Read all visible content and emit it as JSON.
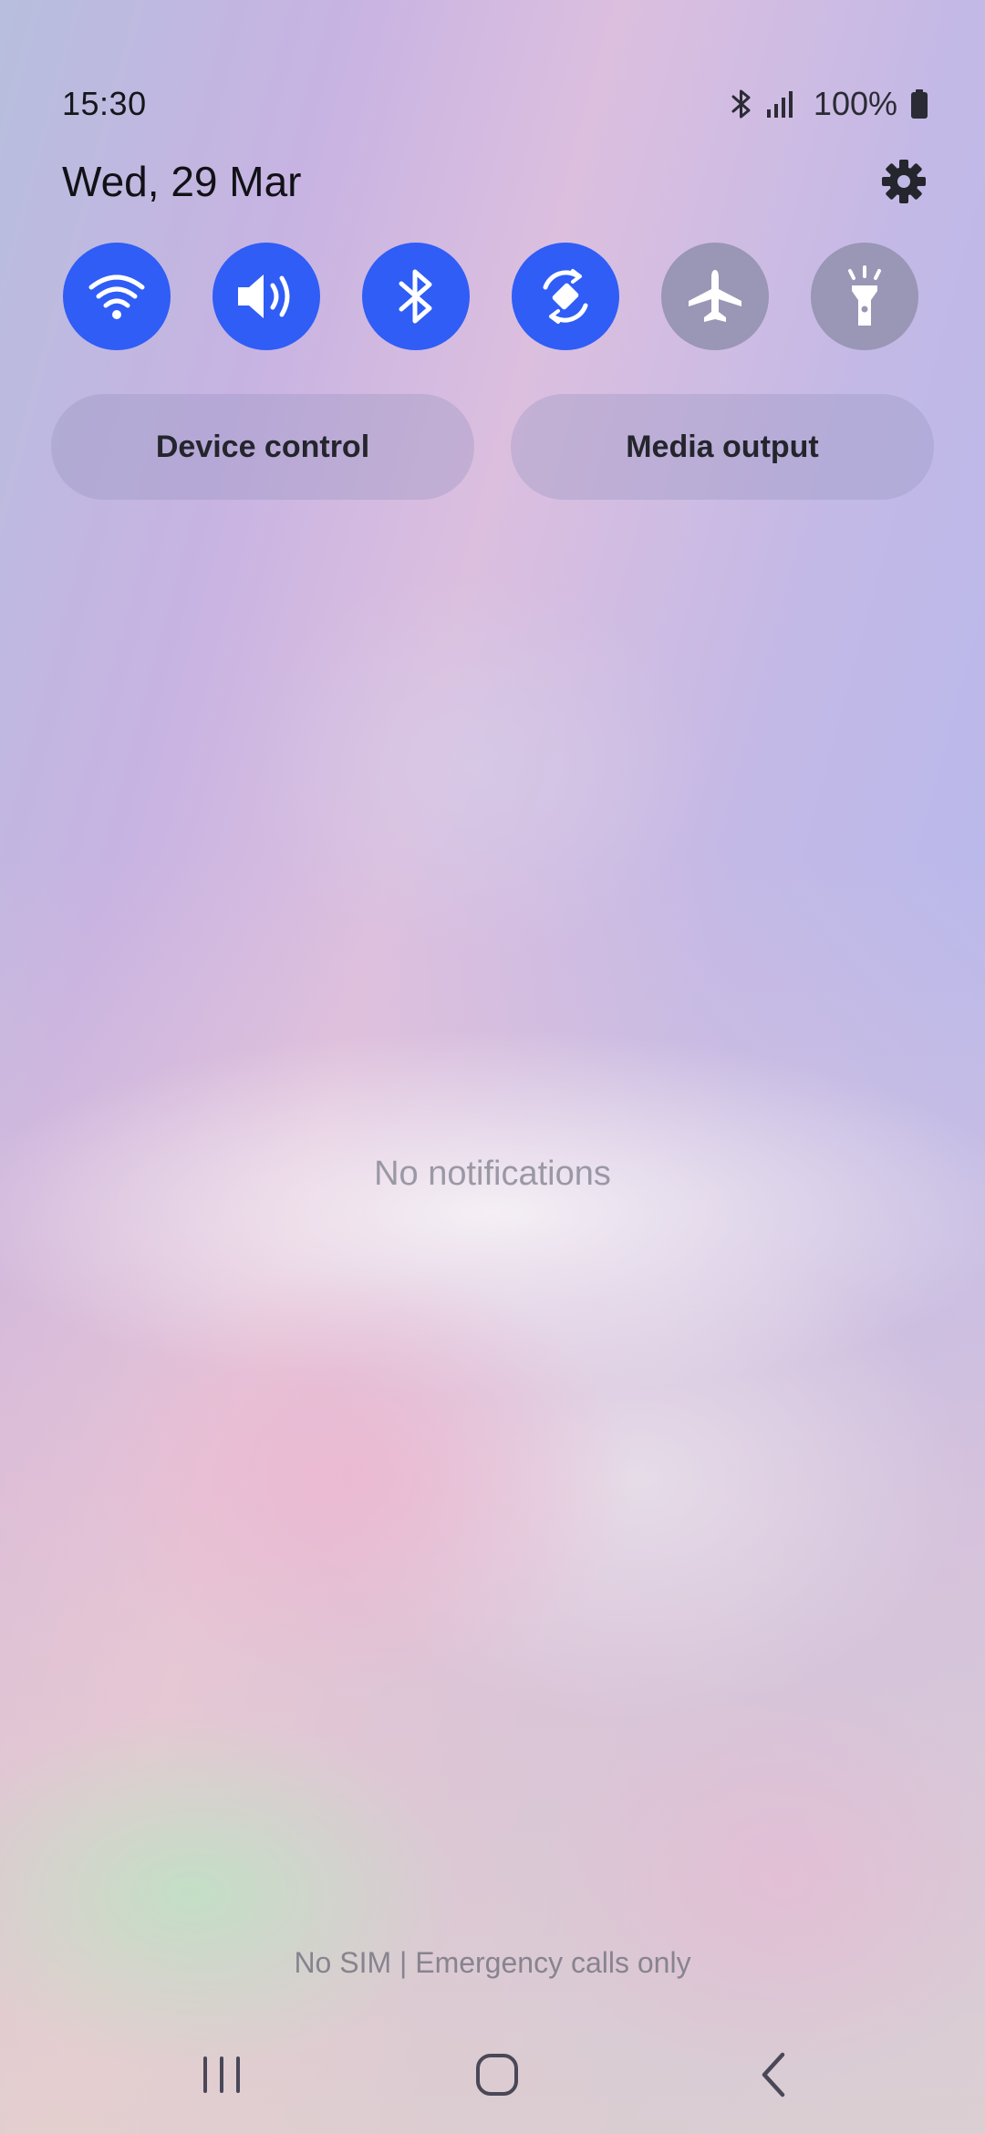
{
  "status_bar": {
    "time": "15:30",
    "battery_percent": "100%",
    "icons": [
      "bluetooth-icon",
      "signal-icon",
      "battery-icon"
    ]
  },
  "header": {
    "date": "Wed, 29 Mar",
    "settings_icon": "gear-icon"
  },
  "quick_tiles": [
    {
      "id": "wifi",
      "icon": "wifi-icon",
      "state": "on"
    },
    {
      "id": "sound",
      "icon": "volume-icon",
      "state": "on"
    },
    {
      "id": "bluetooth",
      "icon": "bluetooth-icon",
      "state": "on"
    },
    {
      "id": "auto-rotate",
      "icon": "rotate-icon",
      "state": "on"
    },
    {
      "id": "airplane-mode",
      "icon": "airplane-icon",
      "state": "off"
    },
    {
      "id": "flashlight",
      "icon": "flashlight-icon",
      "state": "off"
    }
  ],
  "buttons": {
    "device_control": "Device control",
    "media_output": "Media output"
  },
  "notifications": {
    "empty_text": "No notifications"
  },
  "carrier": {
    "text": "No SIM | Emergency calls only"
  },
  "nav_bar": {
    "icons": [
      "recent-apps-icon",
      "home-icon",
      "back-icon"
    ]
  },
  "colors": {
    "tile_on": "#2f5df5",
    "tile_off": "#9a96b5"
  }
}
